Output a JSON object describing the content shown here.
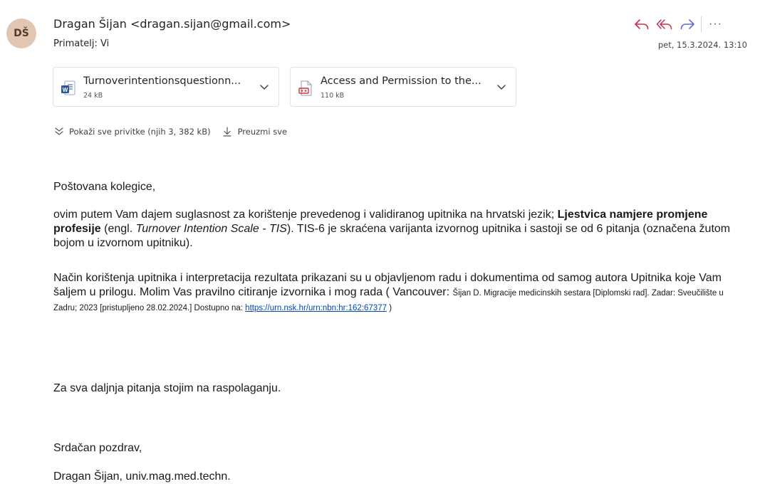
{
  "header": {
    "avatar_initials": "DŠ",
    "sender": "Dragan Šijan <dragan.sijan@gmail.com>",
    "recipient": "Primatelj: Vi",
    "date": "pet, 15.3.2024. 13:10",
    "more_label": "···"
  },
  "attachments": [
    {
      "name": "Turnoverintentionsquestionn...",
      "size": "24 kB",
      "icon": "word-doc-icon"
    },
    {
      "name": "Access and Permission to the...",
      "size": "110 kB",
      "icon": "pdf-doc-icon"
    }
  ],
  "attachment_actions": {
    "show_all": "Pokaži sve privitke (njih 3, 382 kB)",
    "download_all": "Preuzmi sve"
  },
  "body": {
    "greeting": "Poštovana kolegice,",
    "p1_a": "ovim putem Vam dajem suglasnost za korištenje prevedenog i validiranog upitnika na hrvatski jezik; ",
    "p1_bold": "Ljestvica namjere promjene profesije",
    "p1_b": " (engl. ",
    "p1_italic": "Turnover Intention Scale - TIS",
    "p1_c": "). TIS-6 je skraćena varijanta izvornog upitnika i sastoji se od 6 pitanja (označena žutom bojom u izvornom upitniku).",
    "p2_a": "Način korištenja upitnika i interpretacija rezultata prikazani su u objavljenom radu i dokumentima od samog autora Upitnika koje Vam šaljem u prilogu. Molim Vas pravilno citiranje izvornika i mog rada ( Vancouver: ",
    "p2_small": "Šijan D. Migracije medicinskih sestara [Diplomski rad]. Zadar: Sveučilište u Zadru; 2023 [pristupljeno 28.02.2024.] Dostupno na: ",
    "p2_link": "https://urn.nsk.hr/urn:nbn:hr:162:67377",
    "p2_end": " )",
    "p3": "Za sva daljnja pitanja stojim na raspolaganju.",
    "closing": "Srdačan pozdrav,",
    "signature": "Dragan Šijan, univ.mag.med.techn."
  },
  "colors": {
    "accent": "#c4314b",
    "forward": "#5b6bd6",
    "avatar_bg": "#e0c6b3",
    "link": "#0645ad"
  }
}
